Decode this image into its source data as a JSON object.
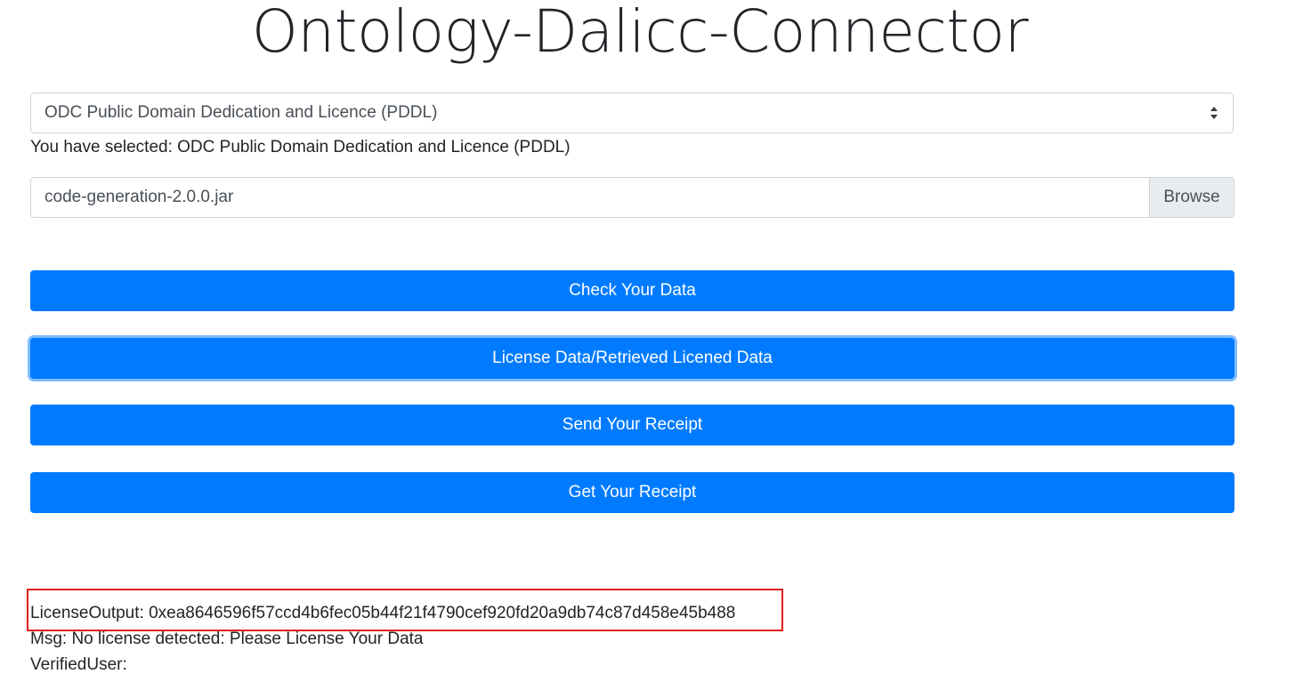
{
  "page": {
    "title": "Ontology-Dalicc-Connector"
  },
  "license_select": {
    "value": "ODC Public Domain Dedication and Licence (PDDL)",
    "selected_text": "You have selected: ODC Public Domain Dedication and Licence (PDDL)",
    "arrow_icon": "select-arrows-icon"
  },
  "file_input": {
    "file_name": "code-generation-2.0.0.jar",
    "browse_label": "Browse"
  },
  "buttons": {
    "check_data": "Check Your Data",
    "license_data": "License Data/Retrieved Licened Data",
    "send_receipt": "Send Your Receipt",
    "get_receipt": "Get Your Receipt"
  },
  "output": {
    "license_output": "LicenseOutput: 0xea8646596f57ccd4b6fec05b44f21f4790cef920fd20a9db74c87d458e45b488",
    "msg": "Msg: No license detected: Please License Your Data",
    "verified_user": "VerifiedUser:"
  },
  "colors": {
    "primary": "#007bff",
    "highlight_box": "#e0201a",
    "text": "#212529",
    "input_text": "#495057"
  }
}
